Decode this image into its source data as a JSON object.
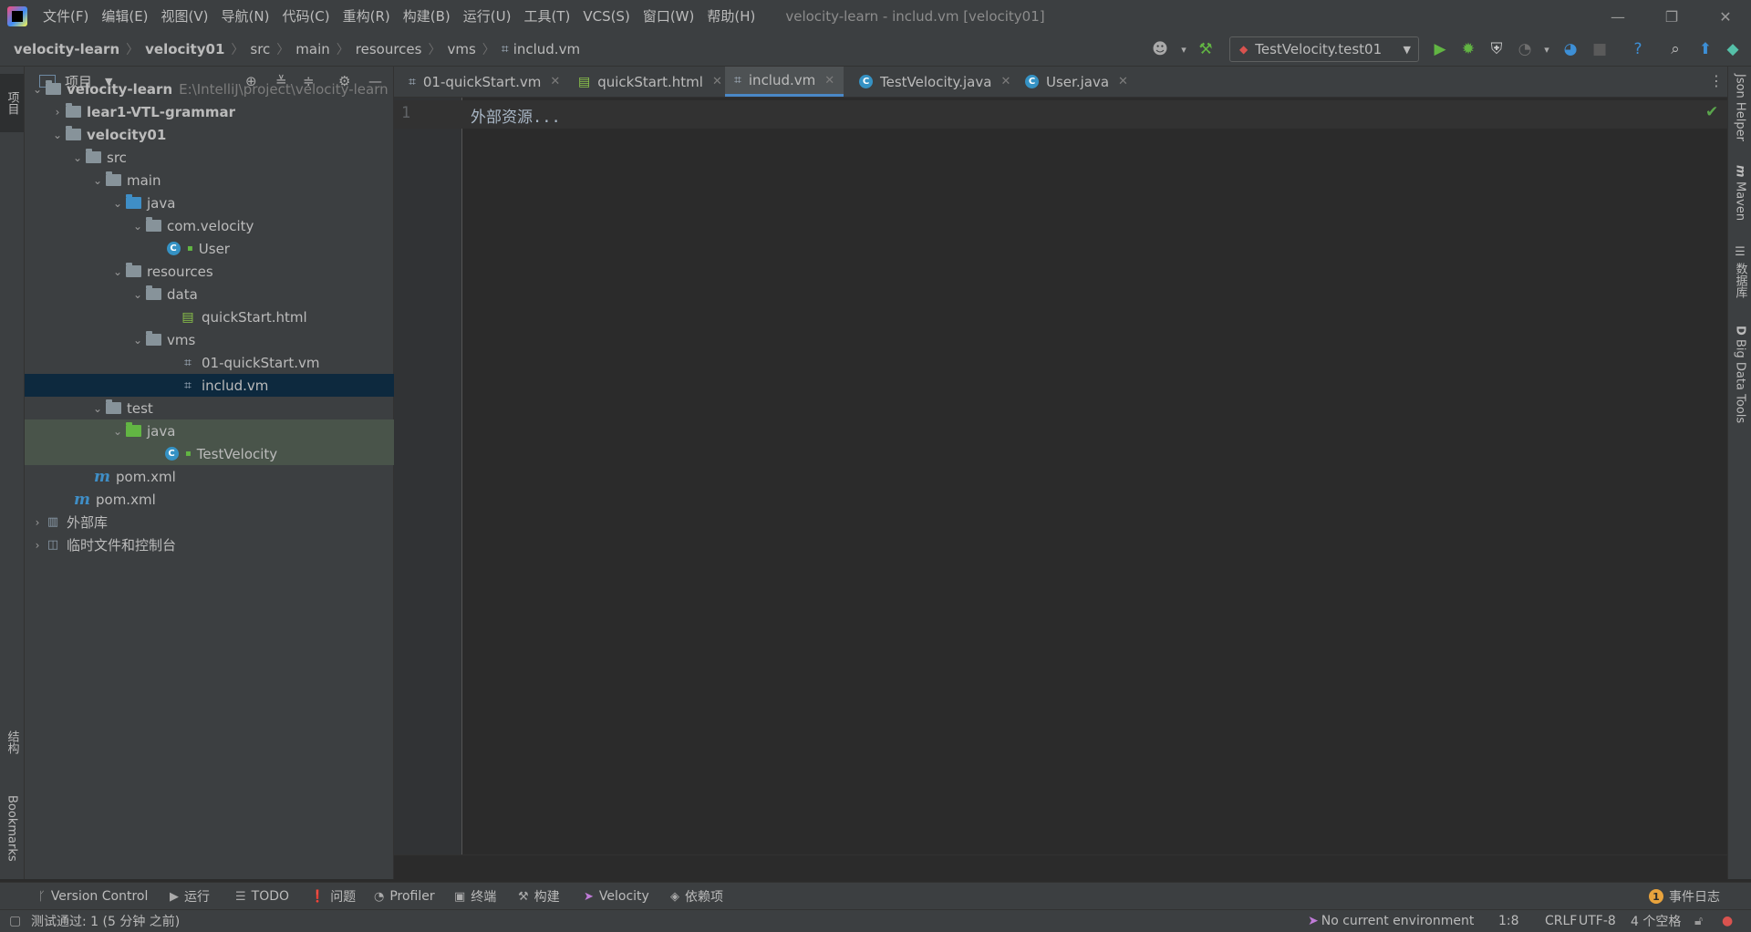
{
  "menu": [
    "文件(F)",
    "编辑(E)",
    "视图(V)",
    "导航(N)",
    "代码(C)",
    "重构(R)",
    "构建(B)",
    "运行(U)",
    "工具(T)",
    "VCS(S)",
    "窗口(W)",
    "帮助(H)"
  ],
  "window_title": "velocity-learn - includ.vm [velocity01]",
  "window_controls": {
    "minimize": "—",
    "restore": "❐",
    "close": "✕"
  },
  "breadcrumb": [
    "velocity-learn",
    "velocity01",
    "src",
    "main",
    "resources",
    "vms",
    "includ.vm"
  ],
  "run_config": {
    "label": "TestVelocity.test01"
  },
  "left_stripe": {
    "project": "项目",
    "structure": "结构",
    "bookmarks": "Bookmarks"
  },
  "project_panel": {
    "title": "项目"
  },
  "tree": [
    {
      "label": "velocity-learn",
      "hint": "E:\\IntelliJ\\project\\velocity-learn"
    },
    {
      "label": "lear1-VTL-grammar"
    },
    {
      "label": "velocity01"
    },
    {
      "label": "src"
    },
    {
      "label": "main"
    },
    {
      "label": "java"
    },
    {
      "label": "com.velocity"
    },
    {
      "label": "User"
    },
    {
      "label": "resources"
    },
    {
      "label": "data"
    },
    {
      "label": "quickStart.html"
    },
    {
      "label": "vms"
    },
    {
      "label": "01-quickStart.vm"
    },
    {
      "label": "includ.vm"
    },
    {
      "label": "test"
    },
    {
      "label": "java"
    },
    {
      "label": "TestVelocity"
    },
    {
      "label": "pom.xml"
    },
    {
      "label": "pom.xml"
    },
    {
      "label": "外部库"
    },
    {
      "label": "临时文件和控制台"
    }
  ],
  "tabs": [
    {
      "label": "01-quickStart.vm"
    },
    {
      "label": "quickStart.html"
    },
    {
      "label": "includ.vm"
    },
    {
      "label": "TestVelocity.java"
    },
    {
      "label": "User.java"
    }
  ],
  "editor": {
    "line_number": "1",
    "code": "外部资源..."
  },
  "right_stripe": {
    "json_helper": "Json Helper",
    "maven": "Maven",
    "database": "数据库",
    "big_data": "Big Data Tools"
  },
  "bottom_tools": [
    "Version Control",
    "运行",
    "TODO",
    "问题",
    "Profiler",
    "终端",
    "构建",
    "Velocity",
    "依赖项",
    "事件日志"
  ],
  "status": {
    "message": "测试通过: 1 (5 分钟 之前)",
    "environment": "No current environment",
    "position": "1:8",
    "line_ending": "CRLF",
    "encoding": "UTF-8",
    "indent": "4 个空格"
  },
  "colors": {
    "accent": "#4a88c7",
    "selected_row": "#0d293e",
    "test_folder_bg": "#49544a",
    "success": "#5aa54c"
  }
}
